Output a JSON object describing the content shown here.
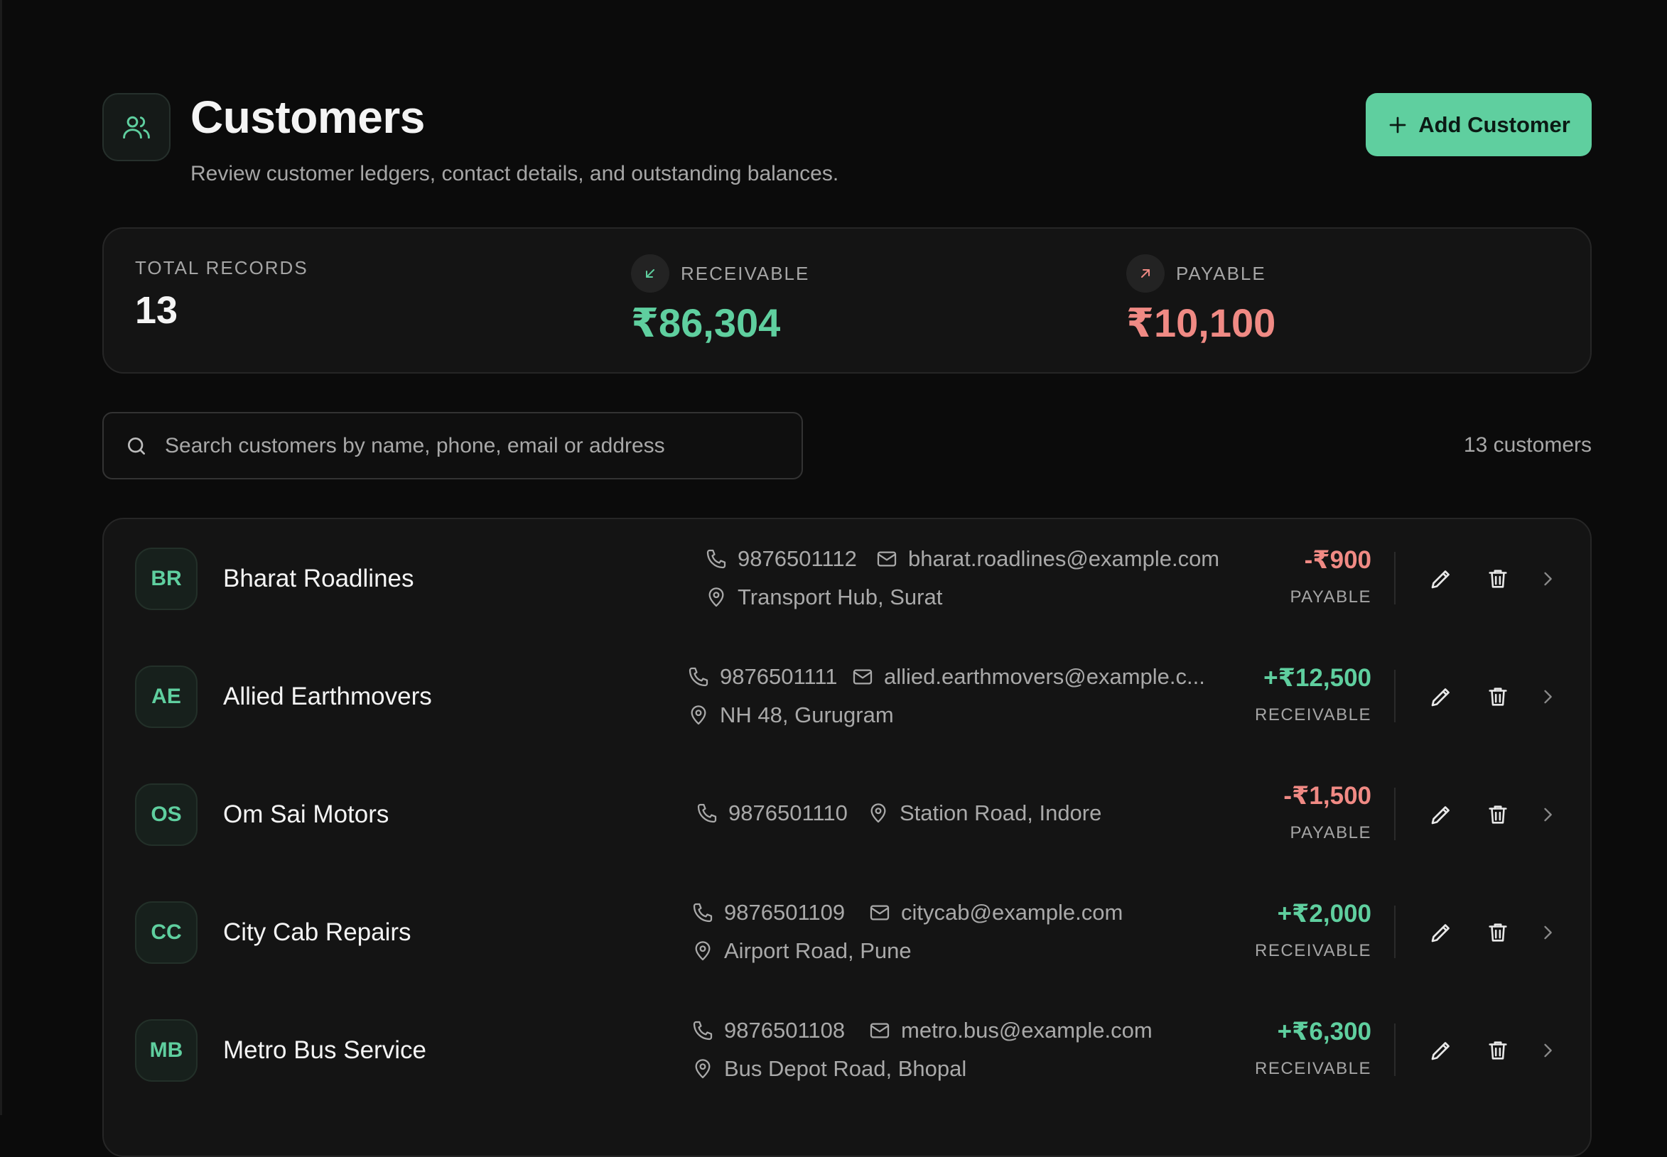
{
  "header": {
    "title": "Customers",
    "subtitle": "Review customer ledgers, contact details, and outstanding balances.",
    "add_button_label": "Add Customer"
  },
  "stats": {
    "total_label": "TOTAL RECORDS",
    "total_value": "13",
    "receivable_label": "RECEIVABLE",
    "receivable_value": "₹86,304",
    "payable_label": "PAYABLE",
    "payable_value": "₹10,100"
  },
  "search": {
    "placeholder": "Search customers by name, phone, email or address",
    "count_text": "13 customers"
  },
  "colors": {
    "accent": "#5fcf9f",
    "payable": "#f08a84",
    "background": "#0b0b0b"
  },
  "customers": [
    {
      "initials": "BR",
      "name": "Bharat Roadlines",
      "phone": "9876501112",
      "email": "bharat.roadlines@example.com",
      "address": "Transport Hub, Surat",
      "amount": "-₹900",
      "status": "PAYABLE"
    },
    {
      "initials": "AE",
      "name": "Allied Earthmovers",
      "phone": "9876501111",
      "email": "allied.earthmovers@example.c...",
      "address": "NH 48, Gurugram",
      "amount": "+₹12,500",
      "status": "RECEIVABLE"
    },
    {
      "initials": "OS",
      "name": "Om Sai Motors",
      "phone": "9876501110",
      "email": "",
      "address": "Station Road, Indore",
      "amount": "-₹1,500",
      "status": "PAYABLE"
    },
    {
      "initials": "CC",
      "name": "City Cab Repairs",
      "phone": "9876501109",
      "email": "citycab@example.com",
      "address": "Airport Road, Pune",
      "amount": "+₹2,000",
      "status": "RECEIVABLE"
    },
    {
      "initials": "MB",
      "name": "Metro Bus Service",
      "phone": "9876501108",
      "email": "metro.bus@example.com",
      "address": "Bus Depot Road, Bhopal",
      "amount": "+₹6,300",
      "status": "RECEIVABLE"
    }
  ]
}
